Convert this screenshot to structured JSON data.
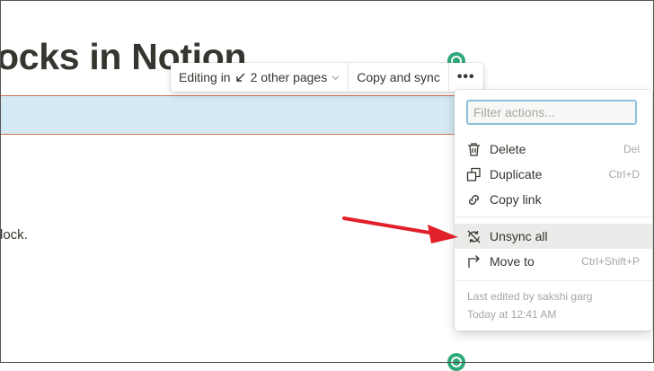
{
  "page": {
    "title": "ocks in Notion",
    "body_text": "lock."
  },
  "toolbar": {
    "editing_label": "Editing in",
    "pages_label": "2 other pages",
    "copy_sync_label": "Copy and sync",
    "more_label": "•••"
  },
  "menu": {
    "filter_placeholder": "Filter actions...",
    "items": [
      {
        "label": "Delete",
        "shortcut": "Del",
        "icon": "trash-icon"
      },
      {
        "label": "Duplicate",
        "shortcut": "Ctrl+D",
        "icon": "duplicate-icon"
      },
      {
        "label": "Copy link",
        "shortcut": "",
        "icon": "link-icon"
      },
      {
        "label": "Unsync all",
        "shortcut": "",
        "icon": "unsync-icon"
      },
      {
        "label": "Move to",
        "shortcut": "Ctrl+Shift+P",
        "icon": "move-to-icon"
      }
    ],
    "last_edited": "Last edited by sakshi garg",
    "timestamp": "Today at 12:41 AM"
  },
  "colors": {
    "synced_block_bg": "#d3e9f3",
    "synced_block_border": "#d9735a",
    "avatar": "#2ea97a",
    "annotation_arrow": "#e0202a",
    "filter_focus_border": "#8ec1dd"
  }
}
